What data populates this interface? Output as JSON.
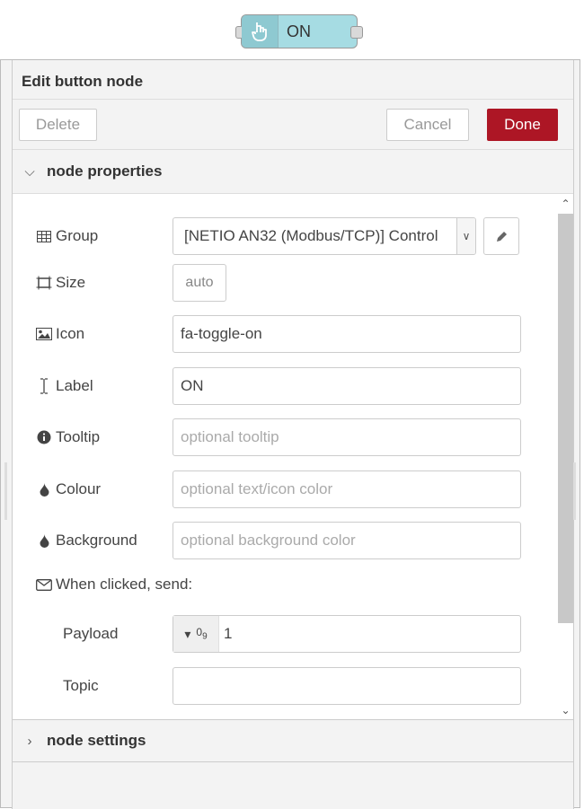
{
  "node_preview": {
    "label": "ON",
    "icon": "hand-pointer-icon"
  },
  "tray": {
    "title": "Edit button node"
  },
  "toolbar": {
    "delete_label": "Delete",
    "cancel_label": "Cancel",
    "done_label": "Done"
  },
  "sections": {
    "properties": "node properties",
    "settings": "node settings"
  },
  "form": {
    "group": {
      "label": "Group",
      "value": "[NETIO AN32 (Modbus/TCP)] Control"
    },
    "size": {
      "label": "Size",
      "value": "auto"
    },
    "icon": {
      "label": "Icon",
      "value": "fa-toggle-on"
    },
    "label": {
      "label": "Label",
      "value": "ON"
    },
    "tooltip": {
      "label": "Tooltip",
      "placeholder": "optional tooltip"
    },
    "colour": {
      "label": "Colour",
      "placeholder": "optional text/icon color"
    },
    "background": {
      "label": "Background",
      "placeholder": "optional background color"
    },
    "when_clicked": {
      "label": "When clicked, send:"
    },
    "payload": {
      "label": "Payload",
      "type_glyph": "09",
      "value": "1"
    },
    "topic": {
      "label": "Topic",
      "value": ""
    }
  },
  "colors": {
    "done": "#ad1625",
    "node": "#a6dce3"
  }
}
